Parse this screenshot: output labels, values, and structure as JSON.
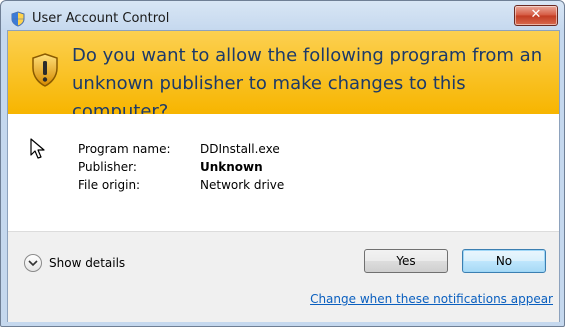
{
  "window": {
    "title": "User Account Control",
    "close_label": "✕"
  },
  "banner": {
    "question": "Do you want to allow the following program from an unknown publisher to make changes to this computer?"
  },
  "details": {
    "rows": [
      {
        "label": "Program name:",
        "value": "DDInstall.exe",
        "bold": false
      },
      {
        "label": "Publisher:",
        "value": "Unknown",
        "bold": true
      },
      {
        "label": "File origin:",
        "value": "Network drive",
        "bold": false
      }
    ]
  },
  "footer": {
    "show_details_label": "Show details",
    "yes_label": "Yes",
    "no_label": "No",
    "change_link": "Change when these notifications appear"
  },
  "colors": {
    "banner": "#f7b500",
    "link": "#0a5fbf",
    "close": "#c23b22"
  }
}
